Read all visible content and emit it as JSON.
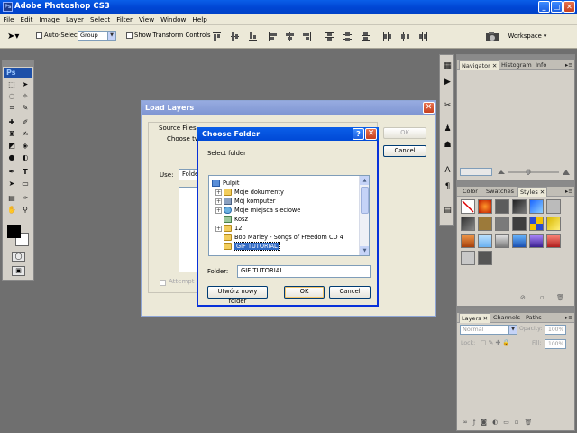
{
  "app": {
    "title": "Adobe Photoshop CS3",
    "icon_text": "Ps"
  },
  "window_controls": {
    "minimize": "_",
    "maximize": "□",
    "close": "✕"
  },
  "menu": [
    "File",
    "Edit",
    "Image",
    "Layer",
    "Select",
    "Filter",
    "View",
    "Window",
    "Help"
  ],
  "options": {
    "auto_select_label": "Auto-Select:",
    "auto_select_value": "Group",
    "transform_label": "Show Transform Controls",
    "workspace": "Workspace ▾"
  },
  "tools": {
    "ps_label": "Ps"
  },
  "navigator_panel": {
    "tabs": [
      "Navigator",
      "Histogram",
      "Info"
    ]
  },
  "color_panel": {
    "tabs": [
      "Color",
      "Swatches",
      "Styles"
    ]
  },
  "layers_panel": {
    "tabs": [
      "Layers",
      "Channels",
      "Paths"
    ],
    "blend_mode": "Normal",
    "opacity_label": "Opacity:",
    "opacity_value": "100%",
    "lock_label": "Lock:",
    "fill_label": "Fill:",
    "fill_value": "100%"
  },
  "load_layers": {
    "title": "Load Layers",
    "source_files": "Source Files",
    "choose_partial": "Choose tw",
    "use_label": "Use:",
    "use_value": "Folde",
    "attempt_partial": "Attempt",
    "ok": "OK",
    "cancel": "Cancel"
  },
  "choose_folder": {
    "title": "Choose Folder",
    "help": "?",
    "close": "✕",
    "prompt": "Select folder",
    "tree": [
      {
        "label": "Pulpit",
        "level": 0,
        "expander": ""
      },
      {
        "label": "Moje dokumenty",
        "level": 1,
        "expander": "+"
      },
      {
        "label": "Mój komputer",
        "level": 1,
        "expander": "+"
      },
      {
        "label": "Moje miejsca sieciowe",
        "level": 1,
        "expander": "+"
      },
      {
        "label": "Kosz",
        "level": 1,
        "expander": ""
      },
      {
        "label": "12",
        "level": 1,
        "expander": "+"
      },
      {
        "label": "Bob Marley - Songs of Freedom CD 4",
        "level": 1,
        "expander": ""
      },
      {
        "label": "GIF TUTORIAL",
        "level": 1,
        "expander": "",
        "selected": true
      }
    ],
    "folder_label": "Folder:",
    "folder_value": "GIF TUTORIAL",
    "new_folder": "Utwórz nowy folder",
    "ok": "OK",
    "cancel": "Cancel"
  },
  "colors": {
    "titlebar": "#0046d4",
    "workspace": "#6f6f6f",
    "panel": "#d4d0c8",
    "selection": "#316ac5"
  }
}
